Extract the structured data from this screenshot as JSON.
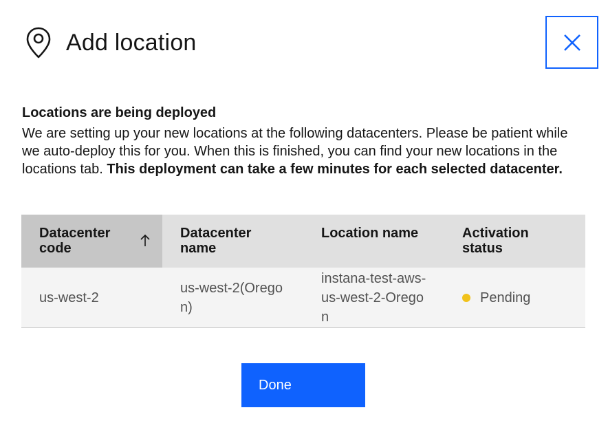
{
  "modal": {
    "title": "Add location",
    "icon": "location-pin-icon",
    "close_icon": "close-icon"
  },
  "content": {
    "heading": "Locations are being deployed",
    "description": "We are setting up your new locations at the following datacenters. Please be patient while we auto-deploy this for you. When this is finished, you can find your new locations in the locations tab. ",
    "description_bold": "This deployment can take a few minutes for each selected datacenter."
  },
  "table": {
    "columns": [
      {
        "label": "Datacenter code",
        "sorted": "ascending"
      },
      {
        "label": "Datacenter name"
      },
      {
        "label": "Location name"
      },
      {
        "label": "Activation status"
      }
    ],
    "rows": [
      {
        "datacenter_code": "us-west-2",
        "datacenter_name": "us-west-2(Oregon)",
        "location_name": "instana-test-aws-us-west-2-Oregon",
        "status": "Pending",
        "status_color": "#f1c21b"
      }
    ]
  },
  "actions": {
    "done_label": "Done"
  },
  "colors": {
    "primary": "#0f62fe",
    "header_bg": "#e0e0e0",
    "sorted_header_bg": "#c6c6c6",
    "row_bg": "#f4f4f4",
    "pending": "#f1c21b"
  }
}
